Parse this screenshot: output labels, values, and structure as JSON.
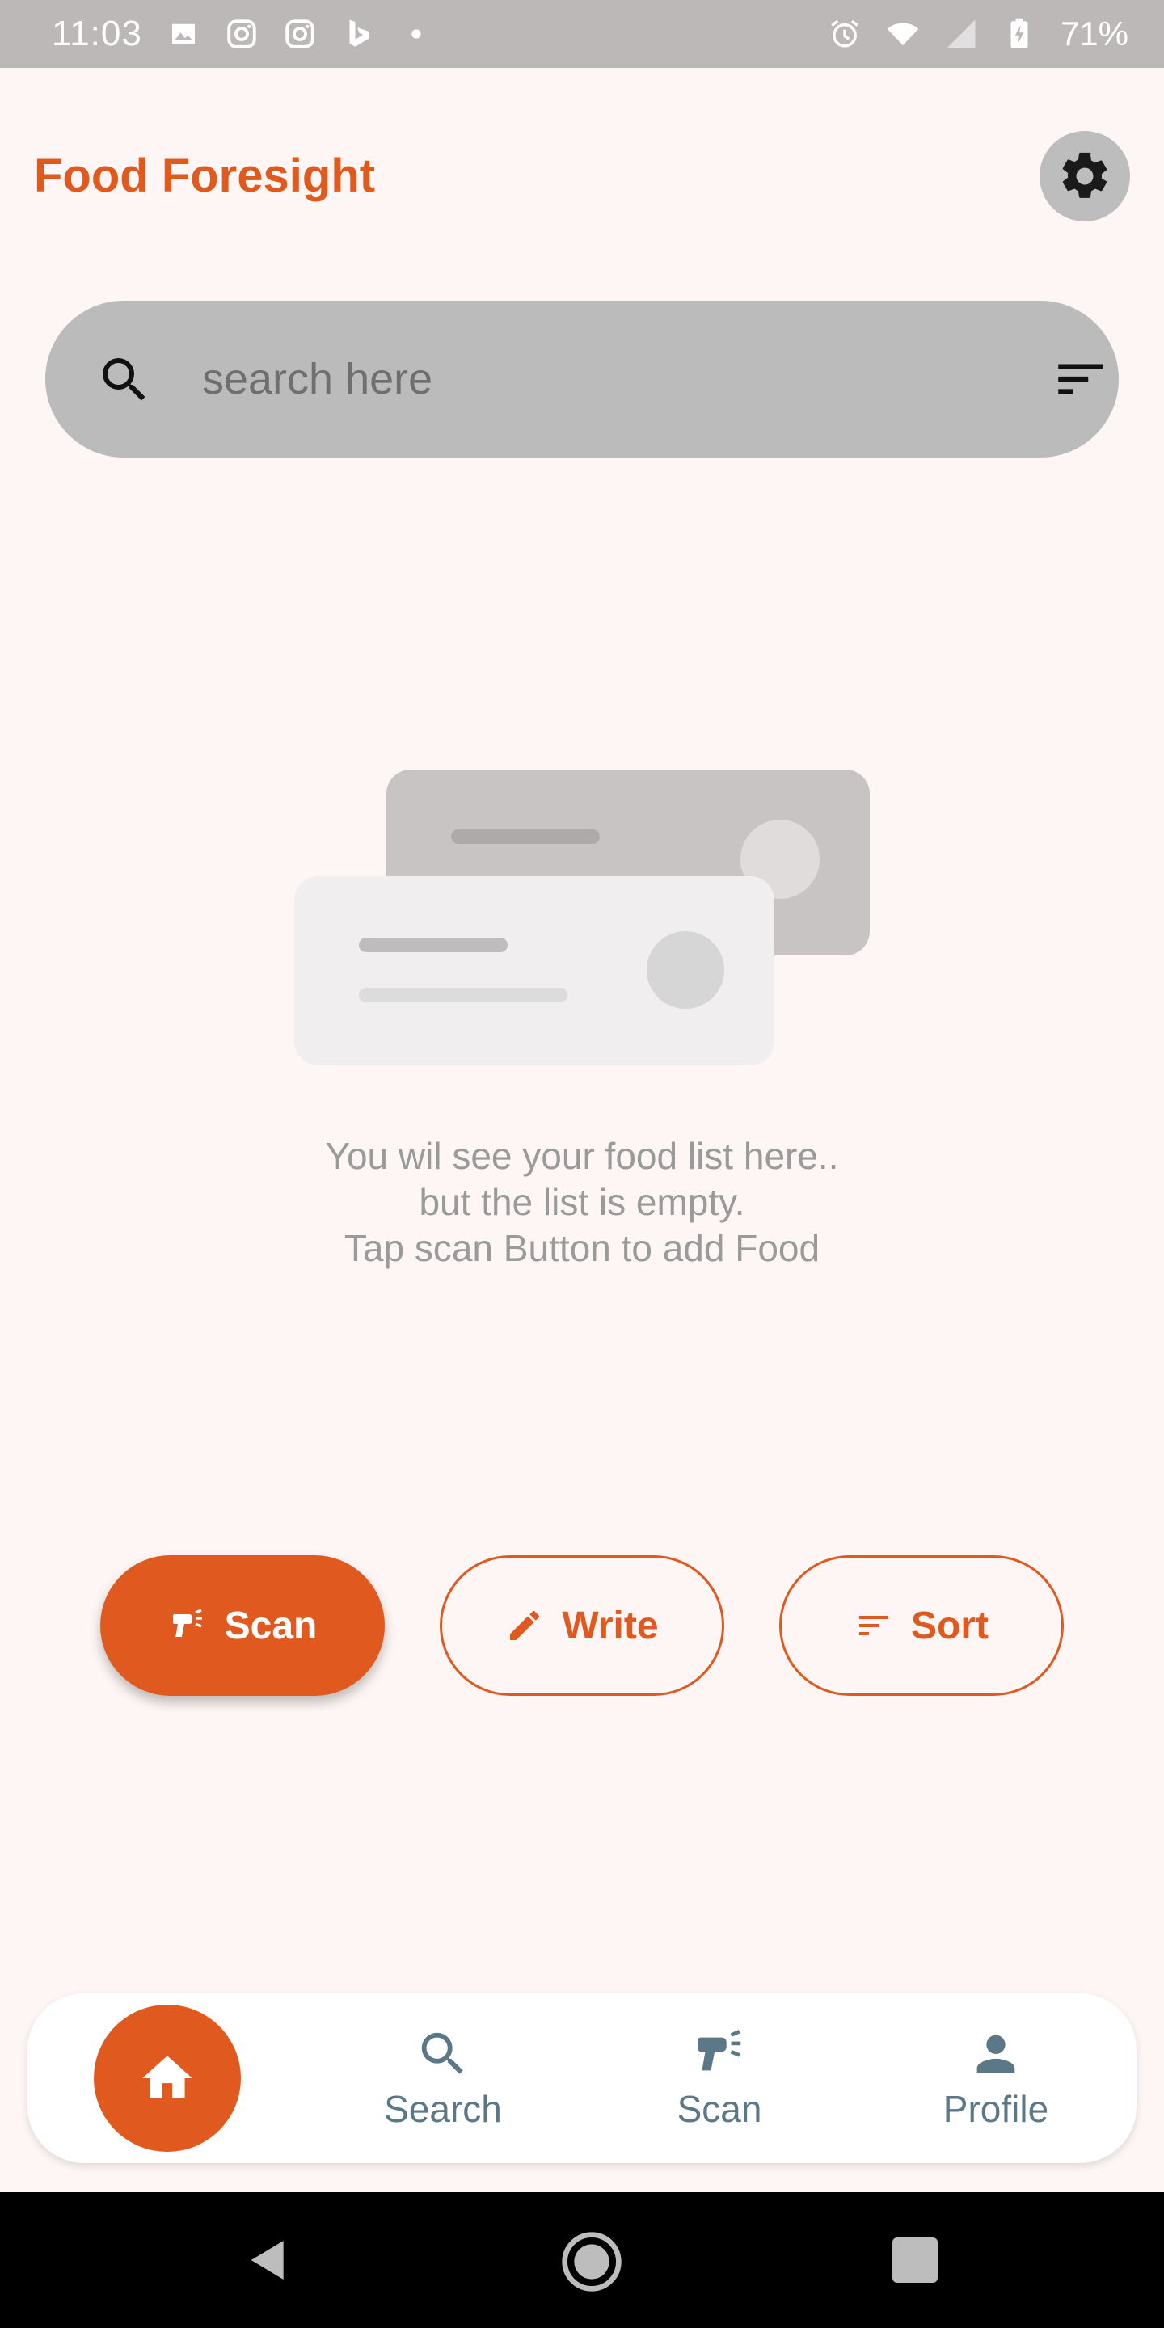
{
  "status_bar": {
    "time": "11:03",
    "battery": "71%",
    "left_icons": [
      "image-icon",
      "instagram-icon",
      "instagram-icon",
      "bing-icon",
      "dot-icon"
    ],
    "right_icons": [
      "alarm-icon",
      "wifi-icon",
      "signal-icon",
      "battery-charging-icon"
    ]
  },
  "app_bar": {
    "title": "Food Foresight",
    "settings_icon": "gear-icon"
  },
  "search": {
    "placeholder": "search here",
    "value": ""
  },
  "empty_state": {
    "line1": "You wil see your food list here..",
    "line2": "but the list is empty.",
    "line3": "Tap scan Button to add Food"
  },
  "actions": {
    "scan_label": "Scan",
    "write_label": "Write",
    "sort_label": "Sort"
  },
  "bottom_nav": {
    "home_icon": "home-icon",
    "search_label": "Search",
    "scan_label": "Scan",
    "profile_label": "Profile",
    "active": "home"
  },
  "colors": {
    "accent": "#e05a1f",
    "background": "#fdf6f4",
    "nav_inactive": "#5b7886"
  }
}
